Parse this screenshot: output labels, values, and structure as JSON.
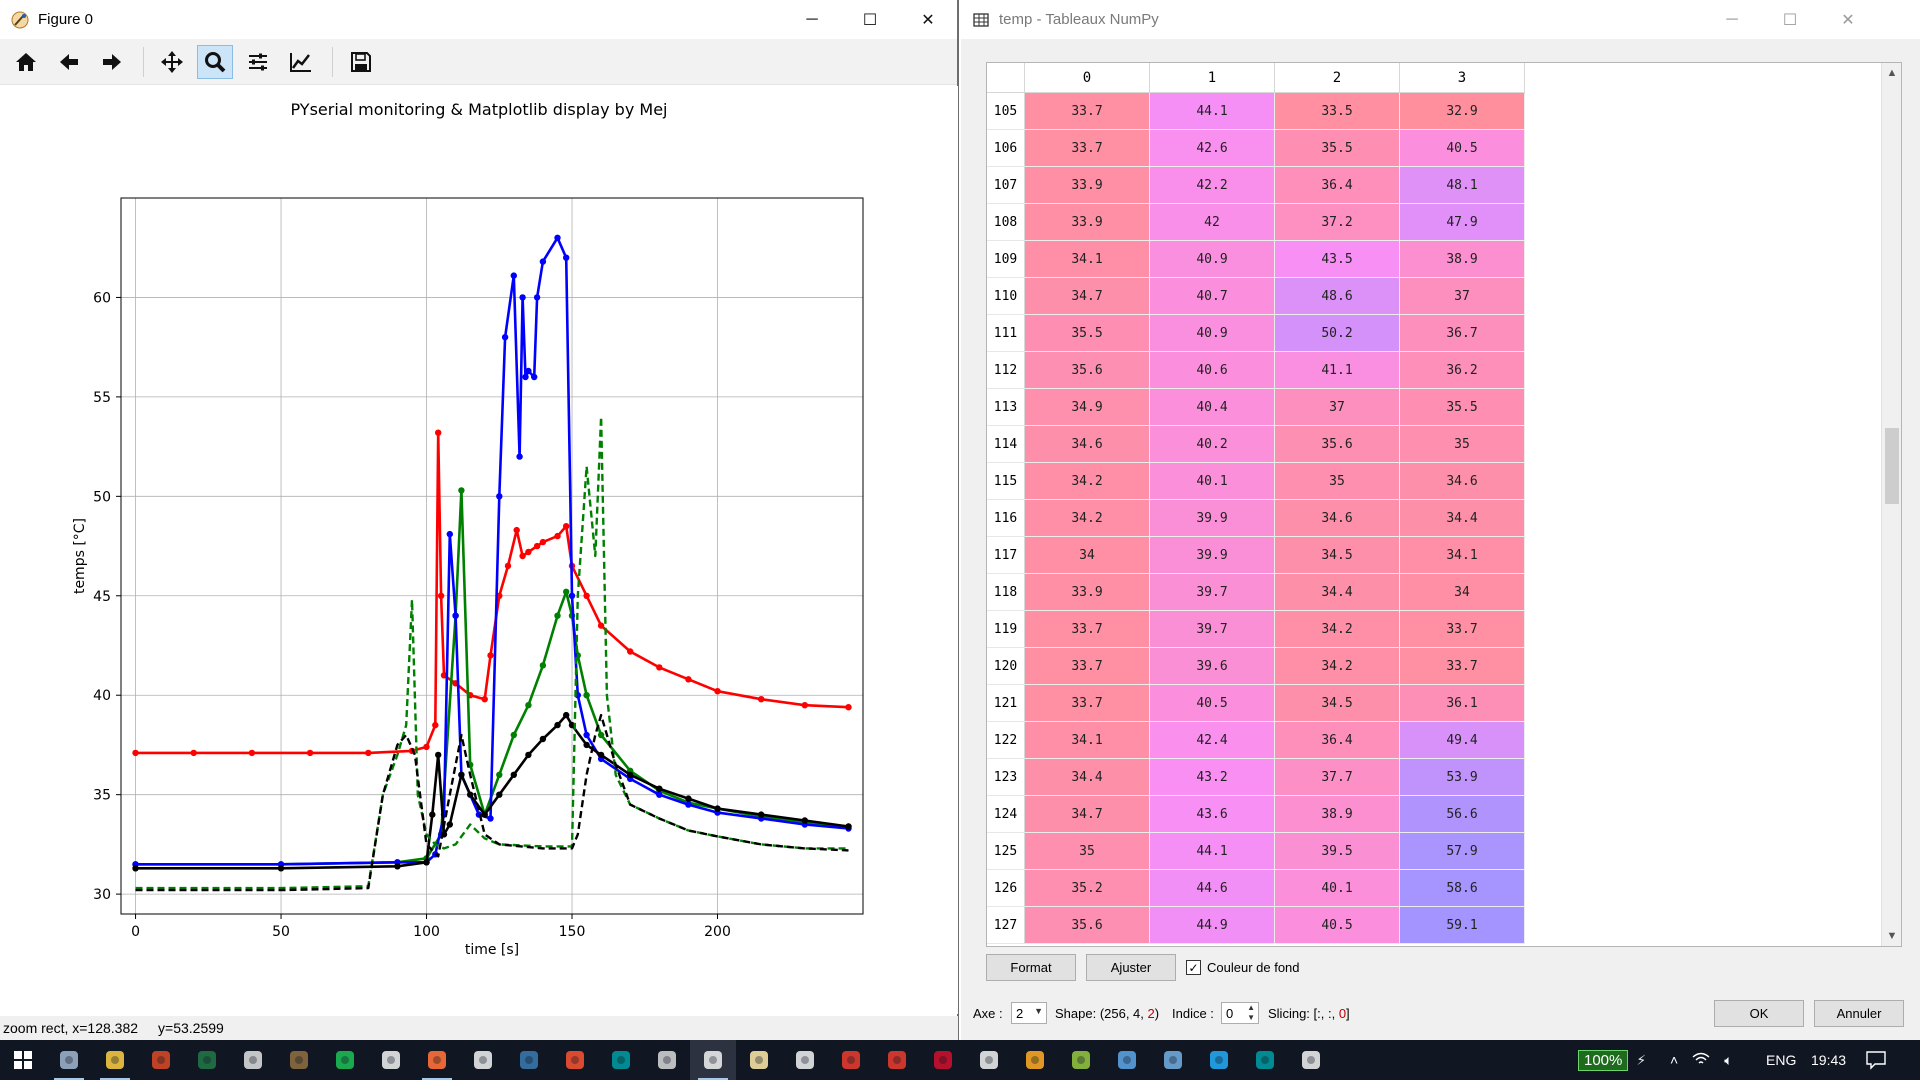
{
  "figure_window": {
    "title": "Figure 0",
    "controls": {
      "minimize": "─",
      "maximize": "☐",
      "close": "✕"
    },
    "toolbar": [
      "home-icon",
      "back-arrow-icon",
      "forward-arrow-icon",
      "pan-icon",
      "zoom-icon",
      "subplots-icon",
      "curve-edit-icon",
      "save-icon"
    ],
    "status_left": "zoom rect, x=128.382",
    "status_right": "y=53.2599"
  },
  "chart_data": {
    "type": "line",
    "title": "PYserial monitoring & Matplotlib display by Mej",
    "xlabel": "time [s]",
    "ylabel": "temps [°C]",
    "xlim": [
      -5,
      250
    ],
    "ylim": [
      29,
      65
    ],
    "xticks": [
      0,
      50,
      100,
      150,
      200
    ],
    "yticks": [
      30,
      35,
      40,
      45,
      50,
      55,
      60
    ],
    "grid": true,
    "series": [
      {
        "color": "#ff0000",
        "style": "solid-dots",
        "x": [
          0,
          20,
          40,
          60,
          80,
          95,
          100,
          103,
          104,
          105,
          106,
          110,
          115,
          120,
          122,
          125,
          128,
          131,
          133,
          135,
          138,
          140,
          145,
          148,
          150,
          155,
          160,
          170,
          180,
          190,
          200,
          215,
          230,
          245
        ],
        "y": [
          37.1,
          37.1,
          37.1,
          37.1,
          37.1,
          37.2,
          37.4,
          38.5,
          53.2,
          45,
          41,
          40.6,
          40,
          39.8,
          42,
          45,
          46.5,
          48.3,
          47,
          47.2,
          47.5,
          47.7,
          48,
          48.5,
          46.5,
          45,
          43.5,
          42.2,
          41.4,
          40.8,
          40.2,
          39.8,
          39.5,
          39.4
        ]
      },
      {
        "color": "#008000",
        "style": "solid-dots",
        "x": [
          0,
          50,
          90,
          100,
          105,
          110,
          112,
          115,
          120,
          125,
          130,
          135,
          140,
          145,
          148,
          150,
          152,
          155,
          160,
          170,
          180,
          190,
          200,
          215,
          230,
          245
        ],
        "y": [
          31.5,
          31.5,
          31.6,
          31.8,
          33,
          44,
          50.3,
          36.5,
          34,
          36,
          38,
          39.5,
          41.5,
          44,
          45.2,
          44,
          42,
          40,
          38,
          36.2,
          35.2,
          34.6,
          34.3,
          33.9,
          33.6,
          33.4
        ]
      },
      {
        "color": "#0000ff",
        "style": "solid-dots",
        "x": [
          0,
          50,
          90,
          100,
          103,
          106,
          108,
          110,
          112,
          118,
          122,
          125,
          127,
          130,
          132,
          133,
          134,
          135,
          137,
          138,
          140,
          145,
          148,
          150,
          152,
          155,
          160,
          170,
          180,
          190,
          200,
          215,
          230,
          245
        ],
        "y": [
          31.5,
          31.5,
          31.6,
          31.6,
          32,
          34,
          48.1,
          44,
          36,
          34,
          33.8,
          50,
          58,
          61.1,
          52,
          60,
          56,
          56.3,
          56,
          60,
          61.8,
          63,
          62,
          45,
          40,
          38,
          36.8,
          35.8,
          35,
          34.5,
          34.1,
          33.8,
          33.5,
          33.3
        ]
      },
      {
        "color": "#000000",
        "style": "solid-dots",
        "x": [
          0,
          50,
          90,
          100,
          102,
          104,
          106,
          108,
          112,
          115,
          120,
          125,
          130,
          135,
          140,
          145,
          148,
          150,
          155,
          160,
          170,
          180,
          190,
          200,
          215,
          230,
          245
        ],
        "y": [
          31.3,
          31.3,
          31.4,
          31.6,
          34,
          37,
          33,
          33.5,
          36,
          35,
          34,
          35,
          36,
          37,
          37.8,
          38.5,
          39,
          38.5,
          37.5,
          37,
          36,
          35.3,
          34.8,
          34.3,
          34,
          33.7,
          33.4
        ]
      },
      {
        "color": "#008000",
        "style": "dashed",
        "x": [
          0,
          50,
          80,
          85,
          90,
          93,
          95,
          97,
          100,
          103,
          106,
          110,
          115,
          120,
          125,
          140,
          150,
          152,
          155,
          156,
          158,
          160,
          162,
          165,
          170,
          180,
          190,
          200,
          215,
          230,
          245
        ],
        "y": [
          30.3,
          30.3,
          30.4,
          35,
          37,
          38.5,
          44.8,
          35,
          33,
          32.5,
          32.3,
          32.5,
          33.5,
          32.8,
          32.5,
          32.4,
          32.4,
          45,
          51.5,
          50,
          47,
          54,
          40,
          36,
          34.5,
          33.8,
          33.2,
          32.9,
          32.5,
          32.3,
          32.3
        ]
      },
      {
        "color": "#000000",
        "style": "dashed",
        "x": [
          0,
          50,
          80,
          85,
          90,
          93,
          96,
          100,
          104,
          108,
          112,
          115,
          120,
          125,
          140,
          150,
          152,
          155,
          158,
          160,
          165,
          170,
          180,
          190,
          200,
          215,
          230,
          245
        ],
        "y": [
          30.2,
          30.2,
          30.3,
          35,
          37.5,
          38,
          37,
          32.5,
          31.9,
          35,
          38,
          36,
          33,
          32.5,
          32.3,
          32.3,
          33,
          36,
          38,
          39,
          36.5,
          34.5,
          33.8,
          33.2,
          32.9,
          32.5,
          32.3,
          32.2
        ]
      }
    ]
  },
  "array_window": {
    "title": "temp - Tableaux NumPy",
    "controls": {
      "minimize": "─",
      "maximize": "☐",
      "close": "✕"
    },
    "columns": [
      "0",
      "1",
      "2",
      "3"
    ],
    "rows": [
      {
        "index": "105",
        "values": [
          "33.7",
          "44.1",
          "33.5",
          "32.9"
        ]
      },
      {
        "index": "106",
        "values": [
          "33.7",
          "42.6",
          "35.5",
          "40.5"
        ]
      },
      {
        "index": "107",
        "values": [
          "33.9",
          "42.2",
          "36.4",
          "48.1"
        ]
      },
      {
        "index": "108",
        "values": [
          "33.9",
          "42",
          "37.2",
          "47.9"
        ]
      },
      {
        "index": "109",
        "values": [
          "34.1",
          "40.9",
          "43.5",
          "38.9"
        ]
      },
      {
        "index": "110",
        "values": [
          "34.7",
          "40.7",
          "48.6",
          "37"
        ]
      },
      {
        "index": "111",
        "values": [
          "35.5",
          "40.9",
          "50.2",
          "36.7"
        ]
      },
      {
        "index": "112",
        "values": [
          "35.6",
          "40.6",
          "41.1",
          "36.2"
        ]
      },
      {
        "index": "113",
        "values": [
          "34.9",
          "40.4",
          "37",
          "35.5"
        ]
      },
      {
        "index": "114",
        "values": [
          "34.6",
          "40.2",
          "35.6",
          "35"
        ]
      },
      {
        "index": "115",
        "values": [
          "34.2",
          "40.1",
          "35",
          "34.6"
        ]
      },
      {
        "index": "116",
        "values": [
          "34.2",
          "39.9",
          "34.6",
          "34.4"
        ]
      },
      {
        "index": "117",
        "values": [
          "34",
          "39.9",
          "34.5",
          "34.1"
        ]
      },
      {
        "index": "118",
        "values": [
          "33.9",
          "39.7",
          "34.4",
          "34"
        ]
      },
      {
        "index": "119",
        "values": [
          "33.7",
          "39.7",
          "34.2",
          "33.7"
        ]
      },
      {
        "index": "120",
        "values": [
          "33.7",
          "39.6",
          "34.2",
          "33.7"
        ]
      },
      {
        "index": "121",
        "values": [
          "33.7",
          "40.5",
          "34.5",
          "36.1"
        ]
      },
      {
        "index": "122",
        "values": [
          "34.1",
          "42.4",
          "36.4",
          "49.4"
        ]
      },
      {
        "index": "123",
        "values": [
          "34.4",
          "43.2",
          "37.7",
          "53.9"
        ]
      },
      {
        "index": "124",
        "values": [
          "34.7",
          "43.6",
          "38.9",
          "56.6"
        ]
      },
      {
        "index": "125",
        "values": [
          "35",
          "44.1",
          "39.5",
          "57.9"
        ]
      },
      {
        "index": "126",
        "values": [
          "35.2",
          "44.6",
          "40.1",
          "58.6"
        ]
      },
      {
        "index": "127",
        "values": [
          "35.6",
          "44.9",
          "40.5",
          "59.1"
        ]
      }
    ],
    "heat_colors": {
      "low": "#ff8f9c",
      "mid": "#f98ff5",
      "high": "#a394ff"
    },
    "buttons": {
      "format": "Format",
      "resize": "Ajuster",
      "ok": "OK",
      "cancel": "Annuler"
    },
    "background_color_label": "Couleur de fond",
    "background_color_checked": true,
    "axis_label": "Axe :",
    "axis_value": "2",
    "shape_prefix": "Shape: (256, 4, ",
    "shape_last": "2",
    "shape_suffix": ")",
    "index_label": "Indice :",
    "index_value": "0",
    "slicing_prefix": "Slicing: [:, :, ",
    "slicing_last": "0",
    "slicing_suffix": "]"
  },
  "taskbar": {
    "apps": [
      "windows-start-icon",
      "spyder-taskbar-icon",
      "file-explorer-icon",
      "powerpoint-icon",
      "excel-icon",
      "7zip-icon",
      "gimp-icon",
      "spotify-icon",
      "paint-icon",
      "firefox-icon",
      "inkscape-icon",
      "python-icon",
      "git-icon",
      "arduino-icon",
      "winamp-icon",
      "matplotlib-figure-icon",
      "text-editor-icon",
      "chrome-icon",
      "foxit-reader-icon",
      "foxit-phantom-icon",
      "scratch-icon",
      "ccleaner-icon",
      "butterfly-icon",
      "notepad-plus-icon",
      "solver-icon",
      "network-app-icon",
      "vscode-icon",
      "arduino-ide-icon",
      "gear-app-icon"
    ],
    "battery": "100%",
    "language": "ENG",
    "time": "19:43"
  }
}
